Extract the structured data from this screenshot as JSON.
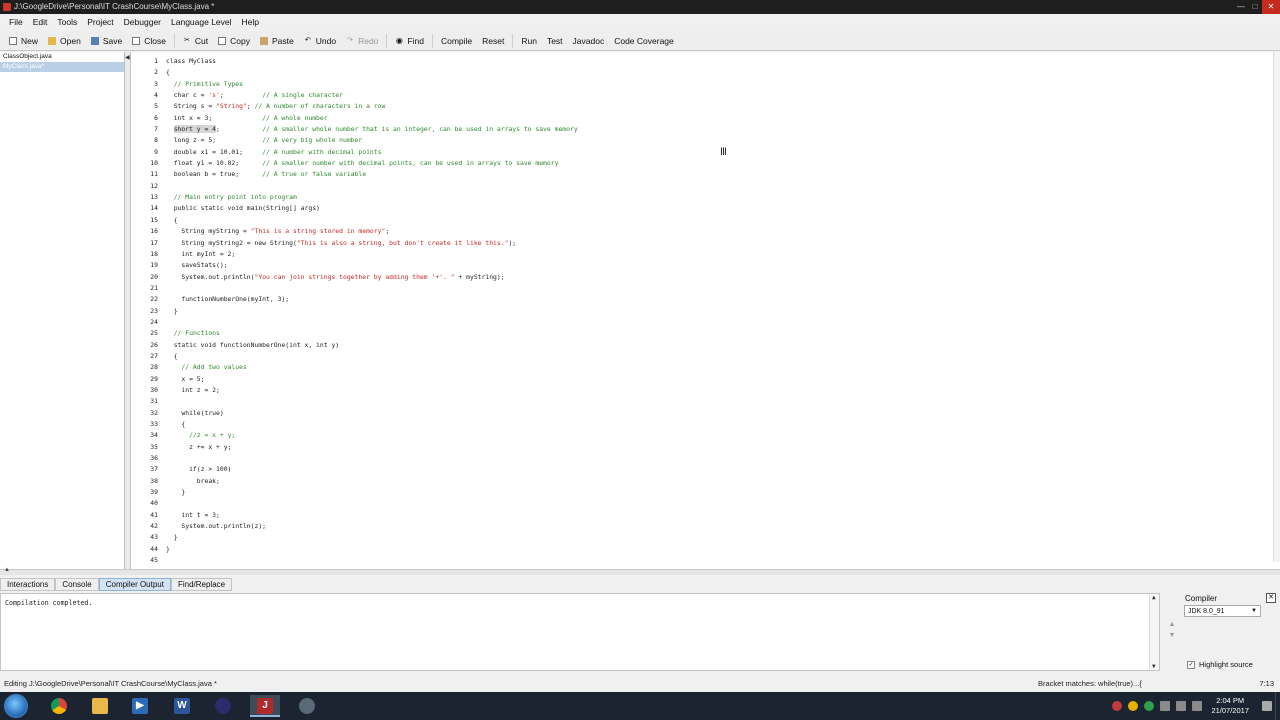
{
  "window": {
    "title": "J:\\GoogleDrive\\Personal\\IT CrashCourse\\MyClass.java *"
  },
  "menu": [
    "File",
    "Edit",
    "Tools",
    "Project",
    "Debugger",
    "Language Level",
    "Help"
  ],
  "toolbar": {
    "new": "New",
    "open": "Open",
    "save": "Save",
    "close": "Close",
    "cut": "Cut",
    "copy": "Copy",
    "paste": "Paste",
    "undo": "Undo",
    "redo": "Redo",
    "find": "Find",
    "compile": "Compile",
    "reset": "Reset",
    "run": "Run",
    "test": "Test",
    "javadoc": "Javadoc",
    "coverage": "Code Coverage"
  },
  "files": [
    {
      "name": "ClassObject.java",
      "active": false
    },
    {
      "name": "MyClass.java*",
      "active": true
    }
  ],
  "code": [
    {
      "n": "1",
      "t": "class MyClass"
    },
    {
      "n": "2",
      "t": "{"
    },
    {
      "n": "3",
      "t": "  // Primitive Types"
    },
    {
      "n": "4",
      "t": "  char c = 's';          // A single character"
    },
    {
      "n": "5",
      "t": "  String s = \"String\"; // A number of characters in a row"
    },
    {
      "n": "6",
      "t": "  int x = 3;             // A whole number"
    },
    {
      "n": "7",
      "t": "  short y = 4;           // A smaller whole number that is an integer, can be used in arrays to save memory"
    },
    {
      "n": "8",
      "t": "  long z = 5;            // A very big whole number"
    },
    {
      "n": "9",
      "t": "  double x1 = 10.01;     // A number with decimal points"
    },
    {
      "n": "10",
      "t": "  float y1 = 10.02;      // A smaller number with decimal points, can be used in arrays to save memory"
    },
    {
      "n": "11",
      "t": "  boolean b = true;      // A true or false variable"
    },
    {
      "n": "12",
      "t": ""
    },
    {
      "n": "13",
      "t": "  // Main entry point into program"
    },
    {
      "n": "14",
      "t": "  public static void main(String[] args)"
    },
    {
      "n": "15",
      "t": "  {"
    },
    {
      "n": "16",
      "t": "    String myString = \"This is a string stored in memory\";"
    },
    {
      "n": "17",
      "t": "    String myString2 = new String(\"This is also a string, but don't create it like this.\");"
    },
    {
      "n": "18",
      "t": "    int myInt = 2;"
    },
    {
      "n": "19",
      "t": "    saveStats();"
    },
    {
      "n": "20",
      "t": "    System.out.println(\"You can join strings together by adding them '+'. \" + myString);"
    },
    {
      "n": "21",
      "t": ""
    },
    {
      "n": "22",
      "t": "    functionNumberOne(myInt, 3);"
    },
    {
      "n": "23",
      "t": "  }"
    },
    {
      "n": "24",
      "t": ""
    },
    {
      "n": "25",
      "t": "  // Functions"
    },
    {
      "n": "26",
      "t": "  static void functionNumberOne(int x, int y)"
    },
    {
      "n": "27",
      "t": "  {"
    },
    {
      "n": "28",
      "t": "    // Add two values"
    },
    {
      "n": "29",
      "t": "    x = 5;"
    },
    {
      "n": "30",
      "t": "    int z = 2;"
    },
    {
      "n": "31",
      "t": ""
    },
    {
      "n": "32",
      "t": "    while(true)"
    },
    {
      "n": "33",
      "t": "    {"
    },
    {
      "n": "34",
      "t": "      //z = x + y;"
    },
    {
      "n": "35",
      "t": "      z += x + y;"
    },
    {
      "n": "36",
      "t": ""
    },
    {
      "n": "37",
      "t": "      if(z > 100)"
    },
    {
      "n": "38",
      "t": "        break;"
    },
    {
      "n": "39",
      "t": "    }"
    },
    {
      "n": "40",
      "t": ""
    },
    {
      "n": "41",
      "t": "    int t = 3;"
    },
    {
      "n": "42",
      "t": "    System.out.println(z);"
    },
    {
      "n": "43",
      "t": "  }"
    },
    {
      "n": "44",
      "t": "}"
    },
    {
      "n": "45",
      "t": ""
    }
  ],
  "bottom": {
    "tabs": [
      {
        "label": "Interactions",
        "active": false
      },
      {
        "label": "Console",
        "active": false
      },
      {
        "label": "Compiler Output",
        "active": true
      },
      {
        "label": "Find/Replace",
        "active": false
      }
    ],
    "output": "Compilation completed.",
    "compiler_label": "Compiler",
    "compiler_value": "JDK 8.0_91",
    "highlight_label": "Highlight source",
    "highlight_checked": true
  },
  "status": {
    "editing": "Editing J:\\GoogleDrive\\Personal\\IT CrashCourse\\MyClass.java *",
    "bracket_match": "Bracket matches:     while(true)...{",
    "position": "7:13"
  },
  "taskbar": {
    "time": "2:04 PM",
    "date": "21/07/2017"
  },
  "colors": {
    "comment": "#2f8a2f",
    "string": "#c82828",
    "selection": "#d6d6d6",
    "active_tab": "#d4e3f4"
  }
}
